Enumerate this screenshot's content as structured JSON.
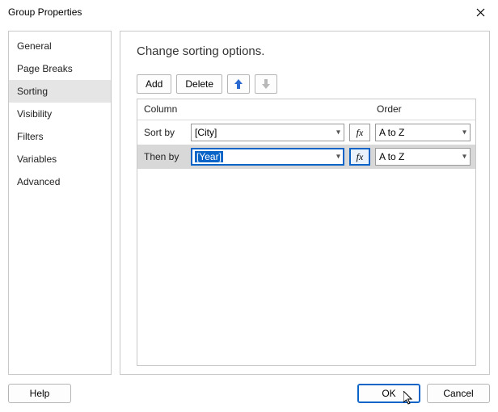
{
  "window": {
    "title": "Group Properties"
  },
  "sidebar": {
    "items": [
      {
        "label": "General"
      },
      {
        "label": "Page Breaks"
      },
      {
        "label": "Sorting"
      },
      {
        "label": "Visibility"
      },
      {
        "label": "Filters"
      },
      {
        "label": "Variables"
      },
      {
        "label": "Advanced"
      }
    ],
    "selected_index": 2
  },
  "main": {
    "title": "Change sorting options.",
    "toolbar": {
      "add_label": "Add",
      "delete_label": "Delete",
      "move_up_icon": "arrow-up",
      "move_down_icon": "arrow-down"
    },
    "grid": {
      "headers": {
        "column": "Column",
        "order": "Order"
      },
      "rows": [
        {
          "label": "Sort by",
          "value": "[City]",
          "order": "A to Z",
          "fx": "fx",
          "selected": false,
          "editing": false
        },
        {
          "label": "Then by",
          "value": "[Year]",
          "order": "A to Z",
          "fx": "fx",
          "selected": true,
          "editing": true
        }
      ]
    }
  },
  "footer": {
    "help_label": "Help",
    "ok_label": "OK",
    "cancel_label": "Cancel"
  }
}
